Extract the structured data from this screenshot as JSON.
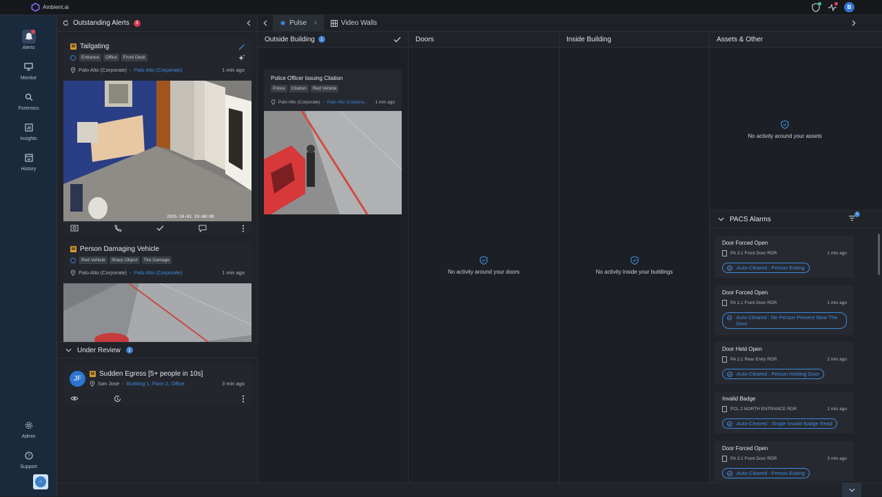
{
  "app": {
    "title": "Ambient.ai",
    "user_initial": "B"
  },
  "nav": {
    "items": [
      {
        "label": "Alerts",
        "icon": "bell-icon"
      },
      {
        "label": "Monitor",
        "icon": "monitor-icon"
      },
      {
        "label": "Forensics",
        "icon": "search-icon"
      },
      {
        "label": "Insights",
        "icon": "chart-icon"
      },
      {
        "label": "History",
        "icon": "archive-icon"
      },
      {
        "label": "Admin",
        "icon": "gear-icon"
      },
      {
        "label": "Support",
        "icon": "help-icon"
      }
    ]
  },
  "outstanding": {
    "title": "Outstanding Alerts",
    "count": "3",
    "alerts": [
      {
        "title": "Tailgating",
        "severity": "M",
        "tags": [
          "Entrance",
          "Office",
          "Front Desk"
        ],
        "location": "Palo Alto (Corporate)",
        "location_link": "Palo Alto (Corporate)",
        "time": "1 min ago",
        "cam_timestamp": "2025-10-01 10:48:00"
      },
      {
        "title": "Person Damaging Vehicle",
        "severity": "M",
        "tags": [
          "Red Vehicle",
          "Sharp Object",
          "Tire Damage"
        ],
        "location": "Palo Alto (Corporate)",
        "location_link": "Palo Alto (Corporate)",
        "time": "1 min ago"
      }
    ]
  },
  "review": {
    "title": "Under Review",
    "count": "1",
    "item": {
      "initials": "JF",
      "severity": "M",
      "title": "Sudden Egress [5+ people in 10s]",
      "location": "San Jose",
      "location_link": "Building 1, Floor 2, Office",
      "time": "3 min ago"
    }
  },
  "tabs": [
    {
      "label": "Pulse",
      "count": "1"
    },
    {
      "label": "Video Walls"
    }
  ],
  "columns": {
    "outside": {
      "title": "Outside Building",
      "count": "1",
      "card": {
        "title": "Police Officer Issuing Citation",
        "tags": [
          "Police",
          "Citation",
          "Red Vehicle"
        ],
        "location": "Palo Alto (Corporate)",
        "location_link": "Palo Alto (Corpora...",
        "time": "1 min ago"
      }
    },
    "doors": {
      "title": "Doors",
      "empty": "No activity around your doors"
    },
    "inside": {
      "title": "Inside Building",
      "empty": "No activity inside your buildings"
    },
    "assets": {
      "title": "Assets & Other",
      "empty": "No activity around your assets"
    }
  },
  "pacs": {
    "title": "PACS Alarms",
    "filter_count": "1",
    "items": [
      {
        "title": "Door Forced Open",
        "reader": "PA 3.1 Front Door RDR",
        "time": "1 min ago",
        "status": "Auto-Cleared : Person Exiting"
      },
      {
        "title": "Door Forced Open",
        "reader": "PA 1.1 Front Door RDR",
        "time": "1 min ago",
        "status": "Auto-Cleared : No Person Present Near The Door"
      },
      {
        "title": "Door Held Open",
        "reader": "PA 2.1 Rear Entry RDR",
        "time": "2 min ago",
        "status": "Auto-Cleared : Person Holding Door"
      },
      {
        "title": "Invalid Badge",
        "reader": "PCL.2 NORTH ENTRANCE RDR",
        "time": "2 min ago",
        "status": "Auto-Cleared : Single Invalid Badge Read"
      },
      {
        "title": "Door Forced Open",
        "reader": "PA 3.1 Front Door RDR",
        "time": "3 min ago",
        "status": "Auto-Cleared : Person Exiting"
      }
    ]
  },
  "colors": {
    "accent": "#3f8ae0",
    "alert_red": "#d8384f",
    "severity_medium": "#d39a2b",
    "nav_bg": "#1a2a3d"
  }
}
